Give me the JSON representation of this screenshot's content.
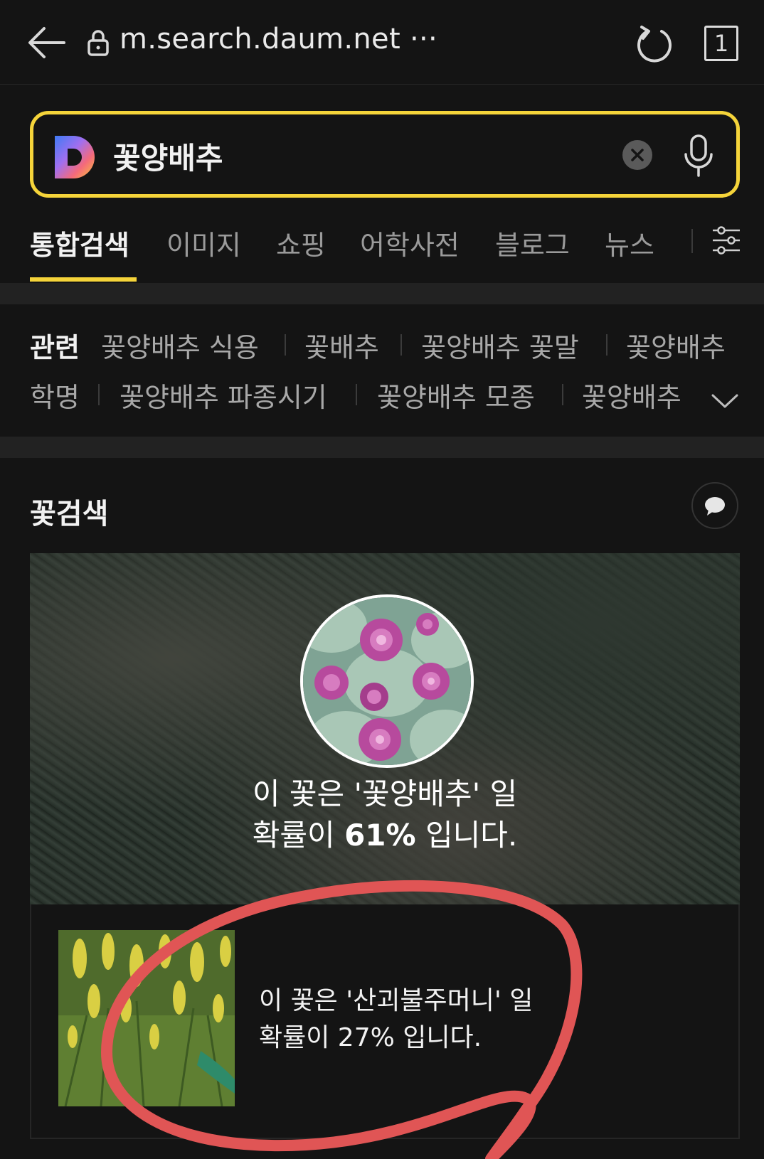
{
  "browser": {
    "url": "m.search.daum.net ···",
    "tab_count": "1"
  },
  "search": {
    "query": "꽃양배추"
  },
  "tabs": [
    {
      "label": "통합검색"
    },
    {
      "label": "이미지"
    },
    {
      "label": "쇼핑"
    },
    {
      "label": "어학사전"
    },
    {
      "label": "블로그"
    },
    {
      "label": "뉴스"
    }
  ],
  "related": {
    "heading": "관련",
    "items": [
      "꽃양배추 식용",
      "꽃배추",
      "꽃양배추 꽃말",
      "꽃양배추",
      "학명",
      "꽃양배추 파종시기",
      "꽃양배추 모종",
      "꽃양배추"
    ]
  },
  "flower_search": {
    "title": "꽃검색",
    "top_result": {
      "line1": "이 꽃은 '꽃양배추' 일",
      "line2_prefix": "확률이 ",
      "percent": "61%",
      "line2_suffix": " 입니다."
    },
    "second_result": {
      "line1": "이 꽃은 '산괴불주머니' 일",
      "line2": "확률이 27% 입니다."
    }
  },
  "colors": {
    "accent": "#f5d43a",
    "background": "#141414",
    "annotation": "#e05555"
  }
}
